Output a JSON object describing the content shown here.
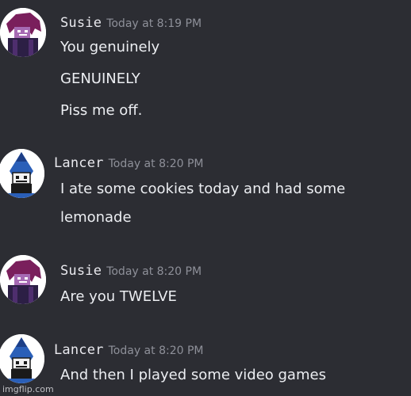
{
  "messages": [
    {
      "username": "Susie",
      "timestamp": "Today at 8:19 PM",
      "avatar_icon": "susie-avatar",
      "lines": [
        "You genuinely",
        "GENUINELY",
        "Piss me off."
      ]
    },
    {
      "username": "Lancer",
      "timestamp": "Today at 8:20 PM",
      "avatar_icon": "lancer-avatar",
      "lines": [
        "I ate some cookies today and had some",
        "lemonade"
      ]
    },
    {
      "username": "Susie",
      "timestamp": "Today at 8:20 PM",
      "avatar_icon": "susie-avatar",
      "lines": [
        "Are you TWELVE"
      ]
    },
    {
      "username": "Lancer",
      "timestamp": "Today at 8:20 PM",
      "avatar_icon": "lancer-avatar",
      "lines": [
        "And then I played some video games"
      ]
    }
  ],
  "watermark": "imgflip.com",
  "colors": {
    "background": "#2c2d33",
    "message_text": "#eceef2",
    "timestamp_text": "#8e9099",
    "susie_hair": "#7a1f5c",
    "lancer_blue": "#2a5fb8"
  }
}
